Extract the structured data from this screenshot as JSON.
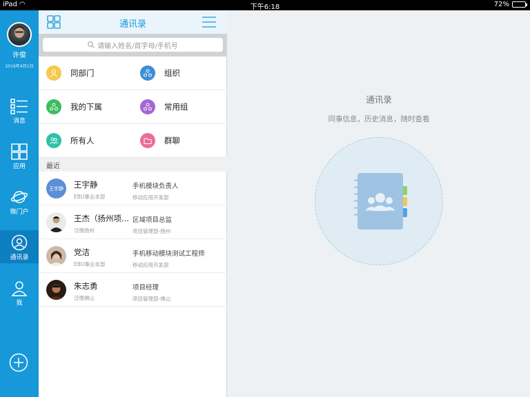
{
  "status": {
    "device": "iPad",
    "time": "下午6:18",
    "battery": "72%",
    "battery_level": 0.72
  },
  "sidebar": {
    "user_name": "许俊",
    "date": "2016年4月1日",
    "nav": [
      {
        "label": "消息",
        "icon": "message-list-icon"
      },
      {
        "label": "应用",
        "icon": "apps-grid-icon"
      },
      {
        "label": "微门户",
        "icon": "planet-icon"
      },
      {
        "label": "通讯录",
        "icon": "contacts-icon",
        "active": true
      },
      {
        "label": "我",
        "icon": "person-icon"
      }
    ],
    "add_icon": "plus-circle-icon"
  },
  "contacts": {
    "title": "通讯录",
    "search_placeholder": "请输入姓名/首字母/手机号",
    "quick": [
      {
        "label": "同部门",
        "icon": "person-icon",
        "color": "#f5c94c"
      },
      {
        "label": "组织",
        "icon": "org-icon",
        "color": "#3b8fd9"
      },
      {
        "label": "我的下属",
        "icon": "org-icon",
        "color": "#3cbd5e"
      },
      {
        "label": "常用组",
        "icon": "org-icon",
        "color": "#a566d4"
      },
      {
        "label": "所有人",
        "icon": "people-icon",
        "color": "#2fc1a8"
      },
      {
        "label": "群聊",
        "icon": "folder-icon",
        "color": "#ec6c9a"
      }
    ],
    "recent_label": "最近",
    "recent": [
      {
        "name": "王宇静",
        "dept": "EBU事业本部",
        "role": "手机模块负责人",
        "sub": "移动应用开发部",
        "avatar_text": "王宇静"
      },
      {
        "name": "王杰（扬州项...",
        "dept": "泛微扬州",
        "role": "区域项目总监",
        "sub": "项目管理部-扬州"
      },
      {
        "name": "党洁",
        "dept": "EBU事业本部",
        "role": "手机移动模块测试工程师",
        "sub": "移动应用开发部"
      },
      {
        "name": "朱志勇",
        "dept": "泛微佛山",
        "role": "项目经理",
        "sub": "项目管理部-佛山"
      }
    ]
  },
  "detail": {
    "title": "通讯录",
    "subtitle": "同事信息，历史消息，随时查看"
  }
}
